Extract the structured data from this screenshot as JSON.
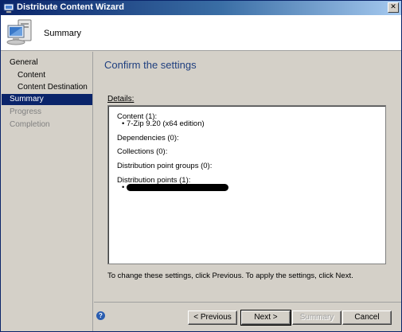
{
  "window": {
    "title": "Distribute Content Wizard",
    "close_glyph": "✕"
  },
  "header": {
    "title": "Summary",
    "icon": "computer-icon"
  },
  "sidebar": {
    "items": [
      {
        "label": "General",
        "state": "normal"
      },
      {
        "label": "Content",
        "state": "normal"
      },
      {
        "label": "Content Destination",
        "state": "normal"
      },
      {
        "label": "Summary",
        "state": "active"
      },
      {
        "label": "Progress",
        "state": "disabled"
      },
      {
        "label": "Completion",
        "state": "disabled"
      }
    ]
  },
  "main": {
    "heading": "Confirm the settings",
    "details_label": "Details:",
    "details": {
      "content_header": "Content (1):",
      "content_item": "•  7-Zip 9.20 (x64 edition)",
      "dependencies": "Dependencies (0):",
      "collections": "Collections (0):",
      "dp_groups": "Distribution point groups (0):",
      "dp_header": "Distribution points (1):",
      "dp_item_bullet": "•"
    },
    "footer_note": "To change these settings, click Previous. To apply the settings, click Next."
  },
  "buttons": {
    "previous": "< Previous",
    "next": "Next >",
    "summary": "Summary",
    "cancel": "Cancel",
    "help_glyph": "?"
  },
  "colors": {
    "titlebar_start": "#0a246a",
    "heading": "#1f3f7f",
    "selection": "#0a246a",
    "face": "#d4d0c8"
  }
}
